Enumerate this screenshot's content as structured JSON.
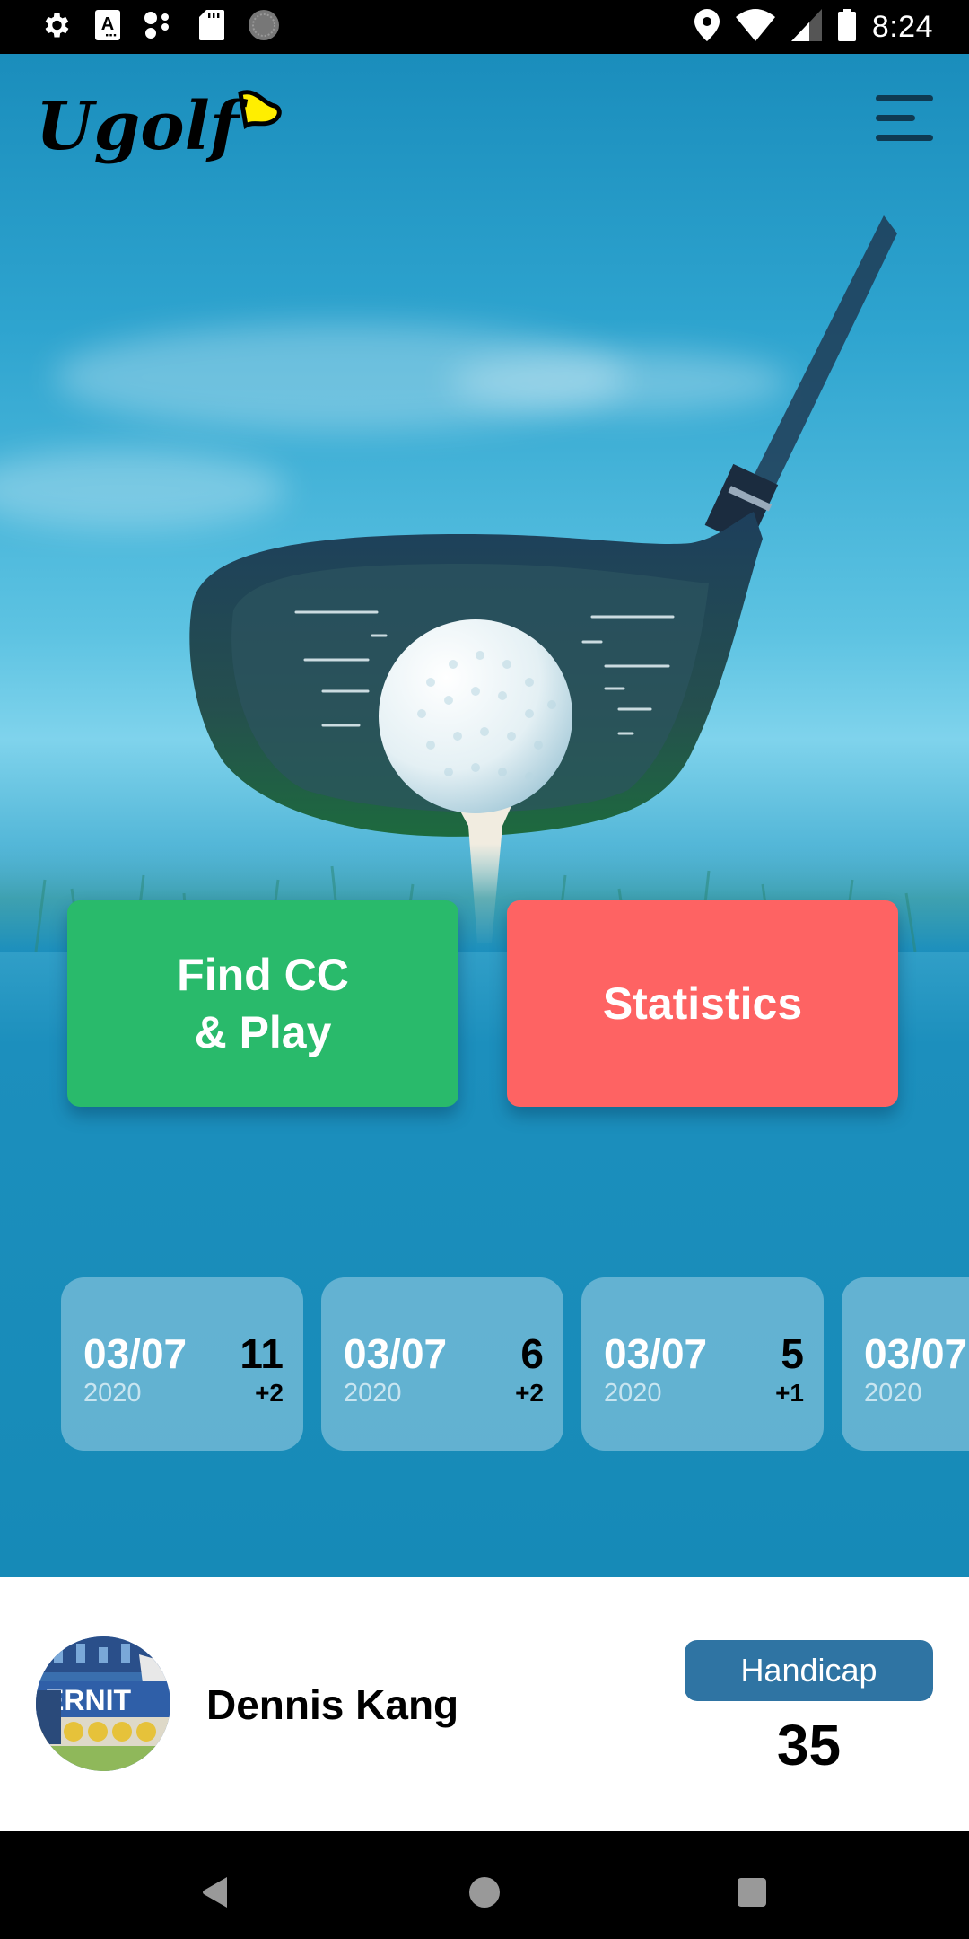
{
  "status_bar": {
    "time": "8:24",
    "left_icons": [
      "settings-icon",
      "text-a-icon",
      "assistant-dots-icon",
      "sd-card-icon",
      "sync-circle-icon"
    ],
    "right_icons": [
      "location-icon",
      "wifi-icon",
      "cellular-signal-icon",
      "battery-icon"
    ]
  },
  "header": {
    "logo_text": "Ugolf",
    "logo_flag_color": "#ffee00",
    "menu_icon": "hamburger-menu-icon"
  },
  "hero": {
    "image": "golf-driver-and-ball-on-tee"
  },
  "actions": {
    "find_play_label": "Find CC\n& Play",
    "find_play_color": "#29ba6b",
    "statistics_label": "Statistics",
    "statistics_color": "#fe6363"
  },
  "rounds": [
    {
      "date": "03/07",
      "year": "2020",
      "score": "11",
      "diff": "+2"
    },
    {
      "date": "03/07",
      "year": "2020",
      "score": "6",
      "diff": "+2"
    },
    {
      "date": "03/07",
      "year": "2020",
      "score": "5",
      "diff": "+1"
    },
    {
      "date": "03/07",
      "year": "2020",
      "score": "",
      "diff": ""
    }
  ],
  "profile": {
    "name": "Dennis Kang",
    "handicap_label": "Handicap",
    "handicap_value": "35",
    "handicap_color": "#2f74a3"
  },
  "nav_bar": {
    "buttons": [
      "back-icon",
      "home-icon",
      "recents-icon"
    ]
  }
}
